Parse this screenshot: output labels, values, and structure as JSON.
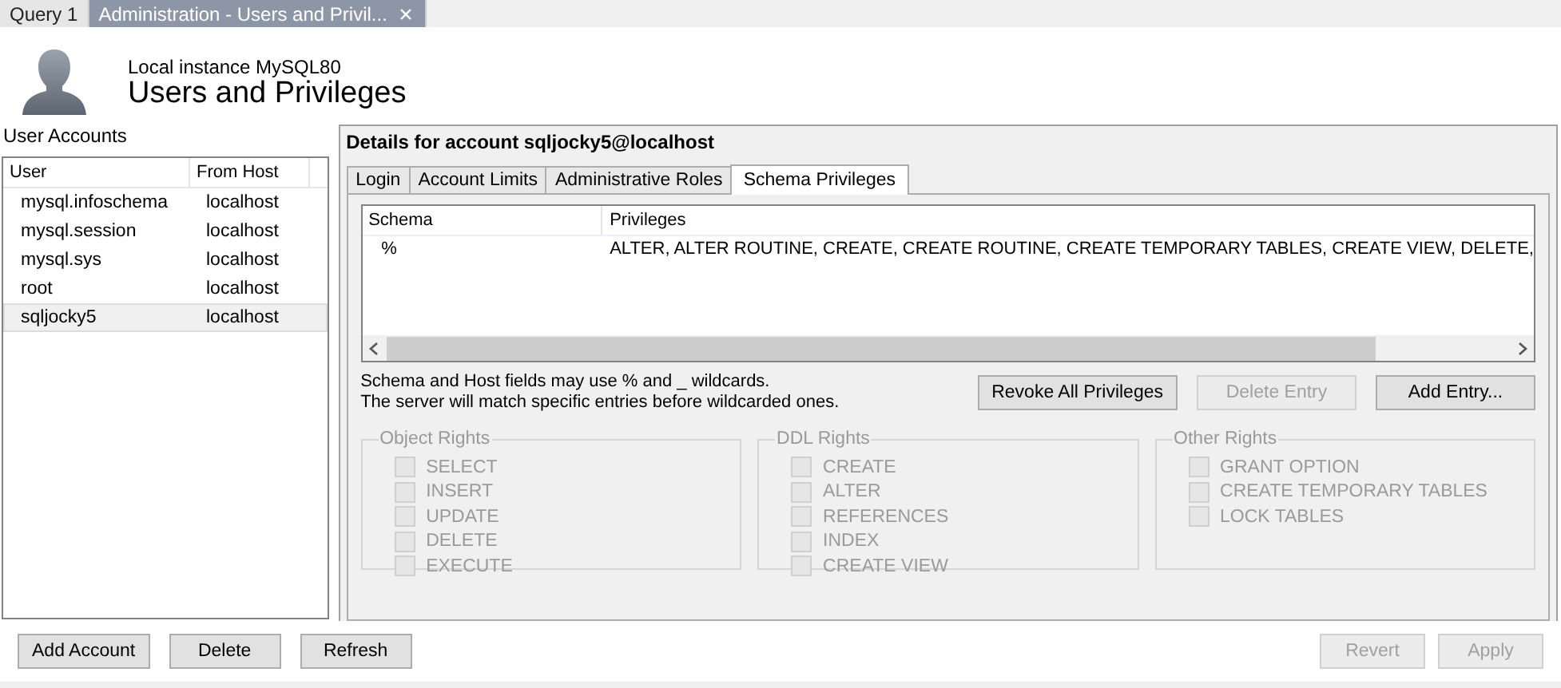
{
  "doc_tabs": [
    {
      "label": "Query 1",
      "selected": false,
      "closable": false
    },
    {
      "label": "Administration - Users and Privil...",
      "selected": true,
      "closable": true
    }
  ],
  "header": {
    "subtitle": "Local instance MySQL80",
    "title": "Users and Privileges"
  },
  "accounts": {
    "title": "User Accounts",
    "columns": [
      "User",
      "From Host"
    ],
    "rows": [
      {
        "user": "mysql.infoschema",
        "host": "localhost",
        "selected": false
      },
      {
        "user": "mysql.session",
        "host": "localhost",
        "selected": false
      },
      {
        "user": "mysql.sys",
        "host": "localhost",
        "selected": false
      },
      {
        "user": "root",
        "host": "localhost",
        "selected": false
      },
      {
        "user": "sqljocky5",
        "host": "localhost",
        "selected": true
      }
    ],
    "buttons": [
      {
        "label": "Add Account",
        "disabled": false
      },
      {
        "label": "Delete",
        "disabled": false
      },
      {
        "label": "Refresh",
        "disabled": false
      }
    ]
  },
  "details": {
    "title": "Details for account sqljocky5@localhost",
    "tabs": [
      {
        "label": "Login",
        "selected": false
      },
      {
        "label": "Account Limits",
        "selected": false
      },
      {
        "label": "Administrative Roles",
        "selected": false
      },
      {
        "label": "Schema Privileges",
        "selected": true
      }
    ],
    "schema_table": {
      "columns": [
        "Schema",
        "Privileges"
      ],
      "rows": [
        {
          "schema": "%",
          "privileges": "ALTER, ALTER ROUTINE, CREATE, CREATE ROUTINE, CREATE TEMPORARY TABLES, CREATE VIEW, DELETE,"
        }
      ]
    },
    "hint": [
      "Schema and Host fields may use % and _ wildcards.",
      "The server will match specific entries before wildcarded ones."
    ],
    "entry_buttons": [
      {
        "label": "Revoke All Privileges",
        "disabled": false
      },
      {
        "label": "Delete Entry",
        "disabled": true
      },
      {
        "label": "Add Entry...",
        "disabled": false
      }
    ],
    "rights": [
      {
        "title": "Object Rights",
        "items": [
          {
            "label": "SELECT",
            "checked": false,
            "disabled": true
          },
          {
            "label": "INSERT",
            "checked": false,
            "disabled": true
          },
          {
            "label": "UPDATE",
            "checked": false,
            "disabled": true
          },
          {
            "label": "DELETE",
            "checked": false,
            "disabled": true
          },
          {
            "label": "EXECUTE",
            "checked": false,
            "disabled": true
          }
        ]
      },
      {
        "title": "DDL Rights",
        "items": [
          {
            "label": "CREATE",
            "checked": false,
            "disabled": true
          },
          {
            "label": "ALTER",
            "checked": false,
            "disabled": true
          },
          {
            "label": "REFERENCES",
            "checked": false,
            "disabled": true
          },
          {
            "label": "INDEX",
            "checked": false,
            "disabled": true
          },
          {
            "label": "CREATE VIEW",
            "checked": false,
            "disabled": true
          }
        ]
      },
      {
        "title": "Other Rights",
        "items": [
          {
            "label": "GRANT OPTION",
            "checked": false,
            "disabled": true
          },
          {
            "label": "CREATE TEMPORARY TABLES",
            "checked": false,
            "disabled": true
          },
          {
            "label": "LOCK TABLES",
            "checked": false,
            "disabled": true
          }
        ]
      }
    ]
  },
  "footer_buttons": [
    {
      "label": "Revert",
      "disabled": true
    },
    {
      "label": "Apply",
      "disabled": true
    }
  ]
}
